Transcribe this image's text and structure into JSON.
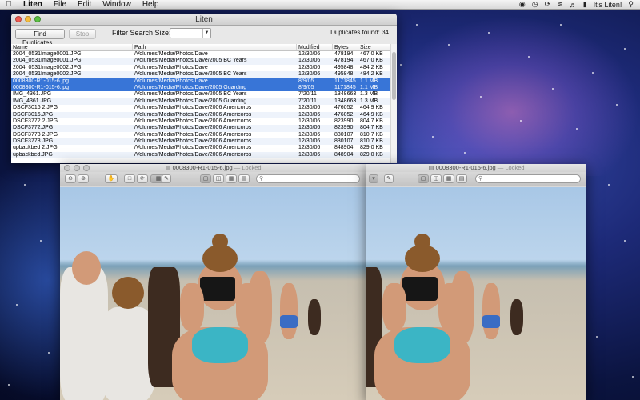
{
  "menubar": {
    "apple": "",
    "items": [
      "Liten",
      "File",
      "Edit",
      "Window",
      "Help"
    ],
    "status_text": "It's Liten!"
  },
  "liten": {
    "title": "Liten",
    "find_button": "Find Duplicates...",
    "stop_button": "Stop",
    "filter_label": "Filter Search Size:",
    "filter_value": "",
    "duplicates_found": "Duplicates found: 34",
    "columns": [
      "Name",
      "Path",
      "Modified",
      "Bytes",
      "Size"
    ],
    "rows": [
      {
        "name": "2004_0531Image0001.JPG",
        "path": "/Volumes/Media/Photos/Dave",
        "modified": "12/30/06",
        "bytes": "478194",
        "size": "467.0 KB",
        "selected": false
      },
      {
        "name": "2004_0531Image0001.JPG",
        "path": "/Volumes/Media/Photos/Dave/2005 BC Years",
        "modified": "12/30/06",
        "bytes": "478194",
        "size": "467.0 KB",
        "selected": false
      },
      {
        "name": "2004_0531Image0002.JPG",
        "path": "/Volumes/Media/Photos/Dave",
        "modified": "12/30/06",
        "bytes": "495848",
        "size": "484.2 KB",
        "selected": false
      },
      {
        "name": "2004_0531Image0002.JPG",
        "path": "/Volumes/Media/Photos/Dave/2005 BC Years",
        "modified": "12/30/06",
        "bytes": "495848",
        "size": "484.2 KB",
        "selected": false
      },
      {
        "name": "0008300-R1-015-6.jpg",
        "path": "/Volumes/Media/Photos/Dave",
        "modified": "8/9/05",
        "bytes": "1171845",
        "size": "1.1 MB",
        "selected": true
      },
      {
        "name": "0008300-R1-015-6.jpg",
        "path": "/Volumes/Media/Photos/Dave/2005 Guarding",
        "modified": "8/9/05",
        "bytes": "1171845",
        "size": "1.1 MB",
        "selected": true
      },
      {
        "name": "IMG_4361.JPG",
        "path": "/Volumes/Media/Photos/Dave/2005 BC Years",
        "modified": "7/20/11",
        "bytes": "1348663",
        "size": "1.3 MB",
        "selected": false
      },
      {
        "name": "IMG_4361.JPG",
        "path": "/Volumes/Media/Photos/Dave/2005 Guarding",
        "modified": "7/20/11",
        "bytes": "1348663",
        "size": "1.3 MB",
        "selected": false
      },
      {
        "name": "DSCF3016 2.JPG",
        "path": "/Volumes/Media/Photos/Dave/2006 Americorps",
        "modified": "12/30/06",
        "bytes": "476052",
        "size": "464.9 KB",
        "selected": false
      },
      {
        "name": "DSCF3016.JPG",
        "path": "/Volumes/Media/Photos/Dave/2006 Americorps",
        "modified": "12/30/06",
        "bytes": "476052",
        "size": "464.9 KB",
        "selected": false
      },
      {
        "name": "DSCF3772 2.JPG",
        "path": "/Volumes/Media/Photos/Dave/2006 Americorps",
        "modified": "12/30/06",
        "bytes": "823990",
        "size": "804.7 KB",
        "selected": false
      },
      {
        "name": "DSCF3772.JPG",
        "path": "/Volumes/Media/Photos/Dave/2006 Americorps",
        "modified": "12/30/06",
        "bytes": "823990",
        "size": "804.7 KB",
        "selected": false
      },
      {
        "name": "DSCF3773 2.JPG",
        "path": "/Volumes/Media/Photos/Dave/2006 Americorps",
        "modified": "12/30/06",
        "bytes": "830107",
        "size": "810.7 KB",
        "selected": false
      },
      {
        "name": "DSCF3773.JPG",
        "path": "/Volumes/Media/Photos/Dave/2006 Americorps",
        "modified": "12/30/06",
        "bytes": "830107",
        "size": "810.7 KB",
        "selected": false
      },
      {
        "name": "upbackbed 2.JPG",
        "path": "/Volumes/Media/Photos/Dave/2006 Americorps",
        "modified": "12/30/06",
        "bytes": "848904",
        "size": "829.0 KB",
        "selected": false
      },
      {
        "name": "upbackbed.JPG",
        "path": "/Volumes/Media/Photos/Dave/2006 Americorps",
        "modified": "12/30/06",
        "bytes": "848904",
        "size": "829.0 KB",
        "selected": false
      }
    ]
  },
  "preview_left": {
    "title": "0008300-R1-015-6.jpg",
    "locked": "— Locked"
  },
  "preview_right": {
    "title": "0008300-R1-015-6.jpg",
    "locked": "— Locked"
  }
}
